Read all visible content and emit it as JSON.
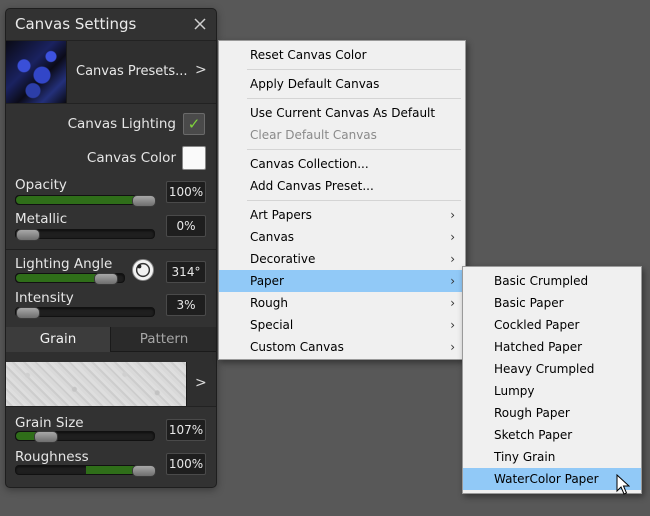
{
  "panel": {
    "title": "Canvas Settings",
    "presets_label": "Canvas Presets...",
    "presets_chevron": ">",
    "lighting_label": "Canvas Lighting",
    "lighting_checked": true,
    "lighting_check_glyph": "✓",
    "color_label": "Canvas Color",
    "canvas_color": "#fafafa",
    "opacity": {
      "label": "Opacity",
      "value": "100%",
      "level": 1.0
    },
    "metallic": {
      "label": "Metallic",
      "value": "0%",
      "level": 0.0
    },
    "lighting_angle": {
      "label": "Lighting Angle",
      "value": "314°"
    },
    "intensity": {
      "label": "Intensity",
      "value": "3%",
      "level": 0.03
    },
    "tabs": {
      "grain": "Grain",
      "pattern": "Pattern",
      "active": "grain"
    },
    "grain_chevron": ">",
    "grain_size": {
      "label": "Grain Size",
      "value": "107%"
    },
    "roughness": {
      "label": "Roughness",
      "value": "100%"
    }
  },
  "menu": {
    "items": [
      {
        "label": "Reset Canvas Color"
      },
      {
        "label": "Apply Default Canvas"
      },
      {
        "label": "Use Current Canvas As Default"
      },
      {
        "label": "Clear Default Canvas",
        "disabled": true
      },
      {
        "label": "Canvas Collection..."
      },
      {
        "label": "Add Canvas Preset..."
      },
      {
        "label": "Art Papers",
        "submenu": true
      },
      {
        "label": "Canvas",
        "submenu": true
      },
      {
        "label": "Decorative",
        "submenu": true
      },
      {
        "label": "Paper",
        "submenu": true,
        "highlighted": true
      },
      {
        "label": "Rough",
        "submenu": true
      },
      {
        "label": "Special",
        "submenu": true
      },
      {
        "label": "Custom Canvas",
        "submenu": true
      }
    ],
    "submenu_glyph": "›"
  },
  "submenu": {
    "items": [
      {
        "label": "Basic Crumpled"
      },
      {
        "label": "Basic Paper"
      },
      {
        "label": "Cockled Paper"
      },
      {
        "label": "Hatched Paper"
      },
      {
        "label": "Heavy Crumpled"
      },
      {
        "label": "Lumpy"
      },
      {
        "label": "Rough Paper"
      },
      {
        "label": "Sketch Paper"
      },
      {
        "label": "Tiny Grain"
      },
      {
        "label": "WaterColor Paper",
        "highlighted": true
      }
    ]
  },
  "colors": {
    "accent_fill": "#2f6e19",
    "highlight": "#91c9f7"
  }
}
